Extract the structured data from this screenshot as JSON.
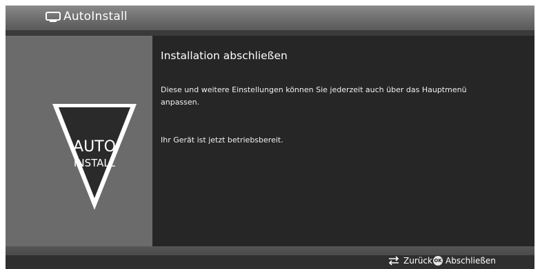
{
  "window": {
    "title": "AutoInstall",
    "icon": "tv-icon"
  },
  "logo": {
    "line1": "AUTO",
    "line2": "INSTALL"
  },
  "main": {
    "heading": "Installation abschließen",
    "paragraph": "Diese und weitere Einstellungen können Sie jederzeit auch über das Hauptmenü anpassen.",
    "status": "Ihr Gerät ist jetzt betriebsbereit."
  },
  "footer": {
    "back_label": "Zurück",
    "ok_badge": "OK",
    "finish_label": "Abschließen"
  },
  "colors": {
    "sidebar": "#6b6b6b",
    "content": "#262626",
    "titlebar": "#7a7a7a"
  }
}
